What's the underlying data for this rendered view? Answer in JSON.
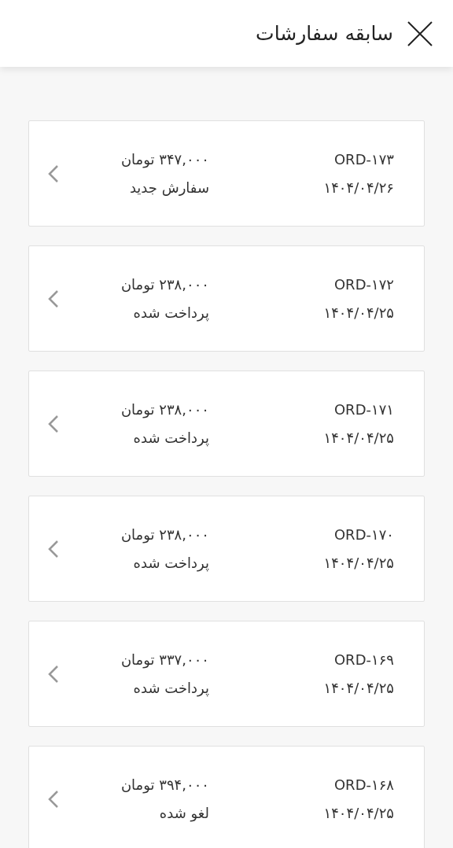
{
  "header": {
    "title": "سابقه سفارشات"
  },
  "orders": [
    {
      "id": "ORD-۱۷۳",
      "date": "۱۴۰۴/۰۴/۲۶",
      "amount": "۳۴۷,۰۰۰ تومان",
      "status": "سفارش جدید"
    },
    {
      "id": "ORD-۱۷۲",
      "date": "۱۴۰۴/۰۴/۲۵",
      "amount": "۲۳۸,۰۰۰ تومان",
      "status": "پرداخت شده"
    },
    {
      "id": "ORD-۱۷۱",
      "date": "۱۴۰۴/۰۴/۲۵",
      "amount": "۲۳۸,۰۰۰ تومان",
      "status": "پرداخت شده"
    },
    {
      "id": "ORD-۱۷۰",
      "date": "۱۴۰۴/۰۴/۲۵",
      "amount": "۲۳۸,۰۰۰ تومان",
      "status": "پرداخت شده"
    },
    {
      "id": "ORD-۱۶۹",
      "date": "۱۴۰۴/۰۴/۲۵",
      "amount": "۳۳۷,۰۰۰ تومان",
      "status": "پرداخت شده"
    },
    {
      "id": "ORD-۱۶۸",
      "date": "۱۴۰۴/۰۴/۲۵",
      "amount": "۳۹۴,۰۰۰ تومان",
      "status": "لغو شده"
    }
  ]
}
